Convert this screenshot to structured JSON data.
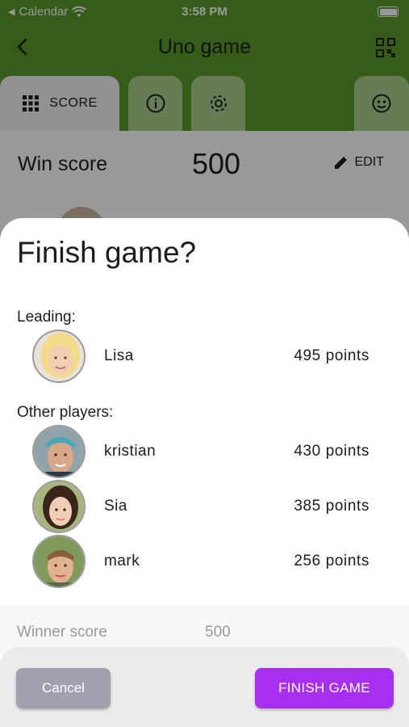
{
  "status_bar": {
    "back_app": "Calendar",
    "time": "3:58 PM"
  },
  "header": {
    "title": "Uno game"
  },
  "tabs": [
    {
      "label": "SCORE",
      "icon": "grid-icon"
    },
    {
      "icon": "info-icon"
    },
    {
      "icon": "gear-icon"
    },
    {
      "icon": "face-icon"
    }
  ],
  "win_score": {
    "label": "Win score",
    "value": "500",
    "edit_label": "EDIT"
  },
  "dialog": {
    "title": "Finish game?",
    "leading_label": "Leading:",
    "leading": [
      {
        "name": "Lisa",
        "points": "495 points"
      }
    ],
    "others_label": "Other players:",
    "others": [
      {
        "name": "kristian",
        "points": "430 points"
      },
      {
        "name": "Sia",
        "points": "385 points"
      },
      {
        "name": "mark",
        "points": "256 points"
      }
    ],
    "winner_label": "Winner score",
    "winner_value": "500",
    "cancel_label": "Cancel",
    "finish_label": "FINISH GAME"
  },
  "colors": {
    "header_green": "#5b9a2a",
    "finish_purple": "#a82ff0",
    "cancel_gray": "#a49fae"
  }
}
